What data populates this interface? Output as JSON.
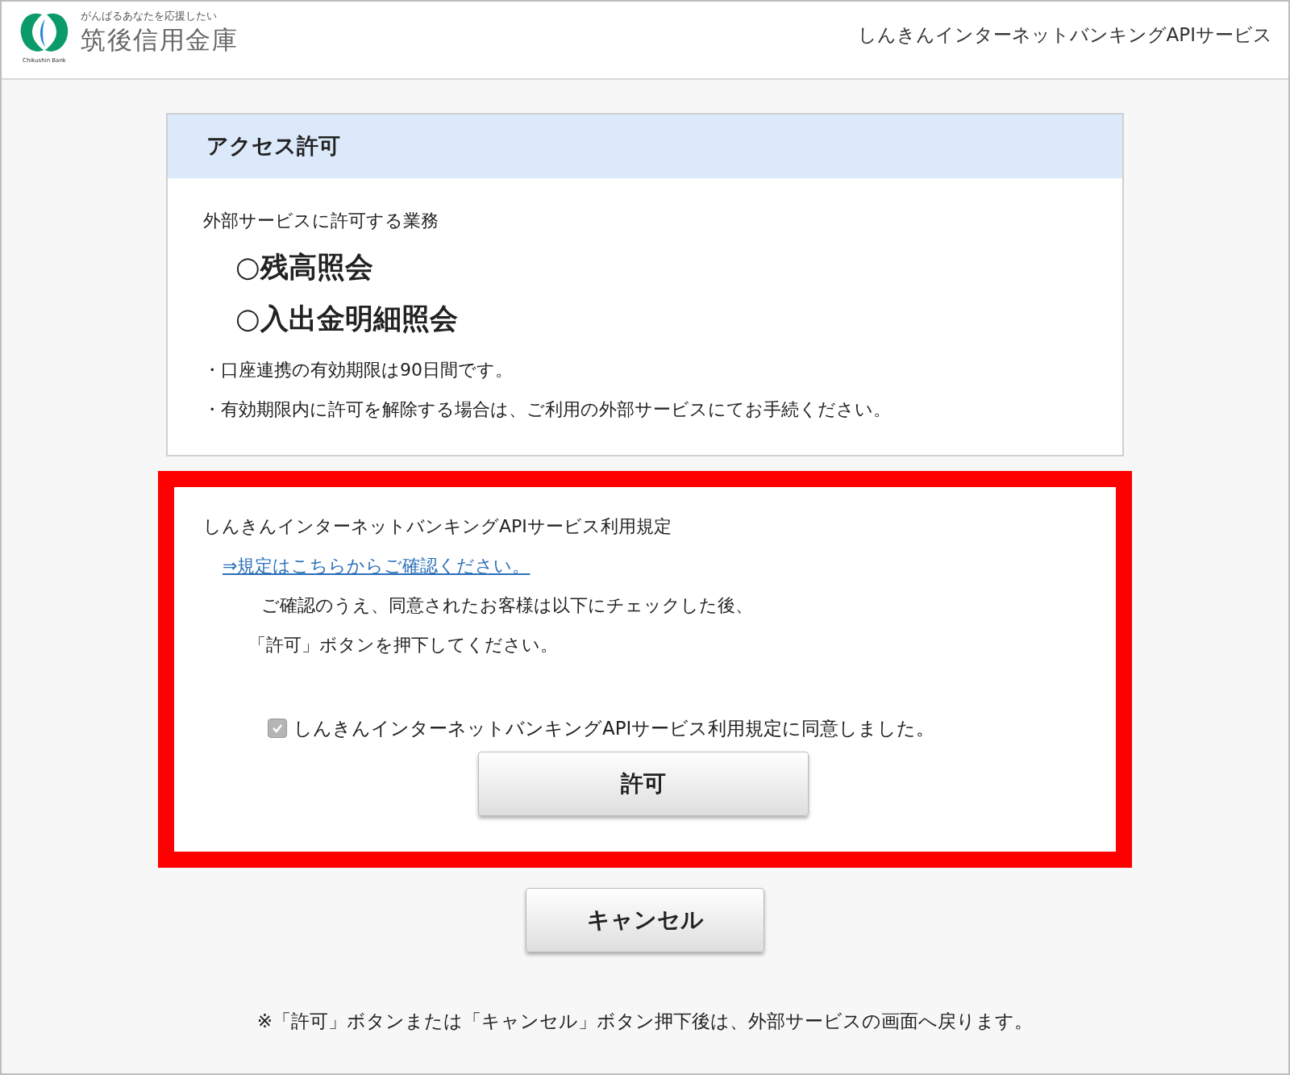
{
  "header": {
    "tagline": "がんばるあなたを応援したい",
    "bank_name": "筑後信用金庫",
    "logo_caption": "Chikushin Bank",
    "service_title": "しんきんインターネットバンキングAPIサービス"
  },
  "access_card": {
    "title": "アクセス許可",
    "subtitle": "外部サービスに許可する業務",
    "services": [
      "○残高照会",
      "○入出金明細照会"
    ],
    "notes": [
      "・口座連携の有効期限は90日間です。",
      "・有効期限内に許可を解除する場合は、ご利用の外部サービスにてお手続ください。"
    ]
  },
  "terms": {
    "title": "しんきんインターネットバンキングAPIサービス利用規定",
    "link": "⇒規定はこちらからご確認ください。",
    "instructions": [
      "ご確認のうえ、同意されたお客様は以下にチェックした後、",
      "「許可」ボタンを押下してください。"
    ],
    "agree": {
      "label": "しんきんインターネットバンキングAPIサービス利用規定に同意しました。",
      "checked": true
    },
    "allow_button": "許可"
  },
  "cancel_button": "キャンセル",
  "footer_note": "※「許可」ボタンまたは「キャンセル」ボタン押下後は、外部サービスの画面へ戻ります。"
}
